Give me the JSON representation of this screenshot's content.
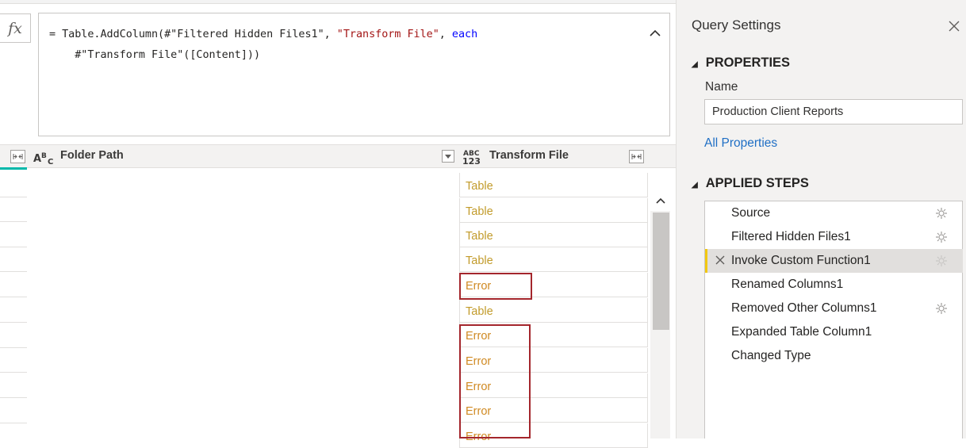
{
  "formula_bar": {
    "fx_label": "fx",
    "line1_a": "= Table.AddColumn(#\"Filtered Hidden Files1\", ",
    "line1_str": "\"Transform File\"",
    "line1_b": ", ",
    "line1_kw": "each",
    "line2": "    #\"Transform File\"([Content]))"
  },
  "grid": {
    "columns": [
      {
        "type_icon": "ABC",
        "title": "Folder Path"
      },
      {
        "type_icon": "ABC 123",
        "title": "Transform File"
      }
    ],
    "transform_file_values": [
      "Table",
      "Table",
      "Table",
      "Table",
      "Error",
      "Table",
      "Error",
      "Error",
      "Error",
      "Error",
      "Error"
    ]
  },
  "query_settings": {
    "title": "Query Settings",
    "properties": {
      "heading": "PROPERTIES",
      "name_label": "Name",
      "name_value": "Production Client Reports",
      "all_properties_link": "All Properties"
    },
    "applied_steps": {
      "heading": "APPLIED STEPS",
      "steps": [
        {
          "label": "Source",
          "has_gear": true,
          "selected": false
        },
        {
          "label": "Filtered Hidden Files1",
          "has_gear": true,
          "selected": false
        },
        {
          "label": "Invoke Custom Function1",
          "has_gear": true,
          "selected": true
        },
        {
          "label": "Renamed Columns1",
          "has_gear": false,
          "selected": false
        },
        {
          "label": "Removed Other Columns1",
          "has_gear": true,
          "selected": false
        },
        {
          "label": "Expanded Table Column1",
          "has_gear": false,
          "selected": false
        },
        {
          "label": "Changed Type",
          "has_gear": false,
          "selected": false
        }
      ]
    }
  },
  "colors": {
    "table_value": "#c29b2b",
    "error_value": "#d08a23",
    "highlight_border": "#a4262c",
    "selected_step_bar": "#f2c811",
    "link": "#1f6fc5",
    "accent_teal": "#01b8aa"
  },
  "icons": {
    "fx": "fx-icon",
    "collapse": "chevron-up-icon",
    "close": "close-icon",
    "expand_column": "expand-column-icon",
    "filter": "filter-dropdown-icon",
    "gear": "gear-icon",
    "delete_step": "delete-step-icon"
  }
}
